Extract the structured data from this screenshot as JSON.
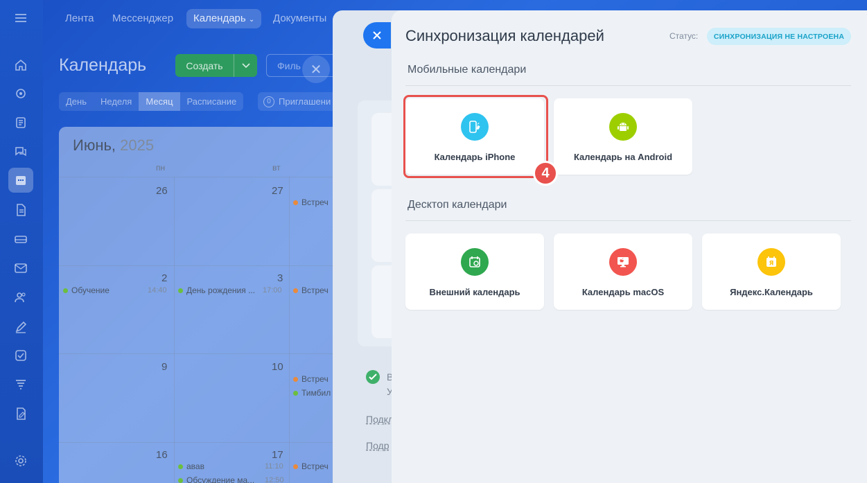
{
  "topnav": {
    "items": [
      {
        "label": "Лента"
      },
      {
        "label": "Мессенджер"
      },
      {
        "label": "Календарь"
      },
      {
        "label": "Документы"
      }
    ]
  },
  "calendar": {
    "title": "Календарь",
    "create_label": "Создать",
    "filter_placeholder": "Филь",
    "views": [
      "День",
      "Неделя",
      "Месяц",
      "Расписание"
    ],
    "invites_count": "0",
    "invites_label": "Приглашени",
    "month": "Июнь,",
    "year": "2025",
    "day_headers": [
      "пн",
      "вт"
    ],
    "weeks": [
      {
        "days": [
          "26",
          "27"
        ]
      },
      {
        "days": [
          "2",
          "3"
        ]
      },
      {
        "days": [
          "9",
          "10"
        ]
      },
      {
        "days": [
          "16",
          "17"
        ]
      }
    ],
    "events": {
      "w1c3": "Встреч",
      "w2c1": "Обучение",
      "w2c1_time": "14:40",
      "w2c2": "День рождения ...",
      "w2c2_time": "17:00",
      "w2c3": "Встреч",
      "w3c3a": "Встреч",
      "w3c3b": "Тимбил",
      "w4c2a": "авав",
      "w4c2a_time": "11:10",
      "w4c2b": "Обсуждение ма...",
      "w4c2b_time": "12:50",
      "w4c3": "Встреч"
    }
  },
  "middle": {
    "line1": "В",
    "line2": "У",
    "link1": "Подкл",
    "link2": "Подр"
  },
  "panel": {
    "title": "Синхронизация календарей",
    "status_label": "Статус:",
    "status_value": "СИНХРОНИЗАЦИЯ НЕ НАСТРОЕНА",
    "mobile_section": "Мобильные календари",
    "desktop_section": "Десктоп календари",
    "mobile_tiles": [
      {
        "label": "Календарь iPhone",
        "icon": "iphone-icon",
        "color": "#2fc3ef"
      },
      {
        "label": "Календарь на Android",
        "icon": "android-icon",
        "color": "#9dcf00"
      }
    ],
    "desktop_tiles": [
      {
        "label": "Внешний календарь",
        "icon": "external-calendar-icon",
        "color": "#2fa84f"
      },
      {
        "label": "Календарь macOS",
        "icon": "macos-icon",
        "color": "#f2554f"
      },
      {
        "label": "Яндекс.Календарь",
        "icon": "yandex-calendar-icon",
        "color": "#fcc40a"
      }
    ],
    "step_number": "4"
  }
}
